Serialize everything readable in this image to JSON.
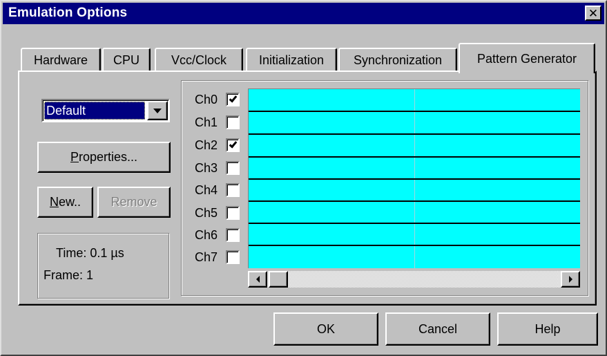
{
  "window": {
    "title": "Emulation Options",
    "close_glyph": "✕"
  },
  "tabs": [
    {
      "label": "Hardware"
    },
    {
      "label": "CPU"
    },
    {
      "label": "Vcc/Clock"
    },
    {
      "label": "Initialization"
    },
    {
      "label": "Synchronization"
    },
    {
      "label": "Pattern Generator",
      "active": true
    }
  ],
  "pattern": {
    "selected": "Default",
    "properties_label_u": "P",
    "properties_label_rest": "roperties...",
    "new_label_u": "N",
    "new_label_rest": "ew..",
    "remove_label": "Remove",
    "time_text": "Time: 0.1 µs",
    "frame_text": "Frame: 1"
  },
  "channels": [
    {
      "label": "Ch0",
      "checked": true
    },
    {
      "label": "Ch1",
      "checked": false
    },
    {
      "label": "Ch2",
      "checked": true
    },
    {
      "label": "Ch3",
      "checked": false
    },
    {
      "label": "Ch4",
      "checked": false
    },
    {
      "label": "Ch5",
      "checked": false
    },
    {
      "label": "Ch6",
      "checked": false
    },
    {
      "label": "Ch7",
      "checked": false
    }
  ],
  "colors": {
    "grid": "#00ffff",
    "title": "#000080",
    "face": "#c0c0c0"
  },
  "footer": {
    "ok": "OK",
    "cancel": "Cancel",
    "help": "Help"
  }
}
